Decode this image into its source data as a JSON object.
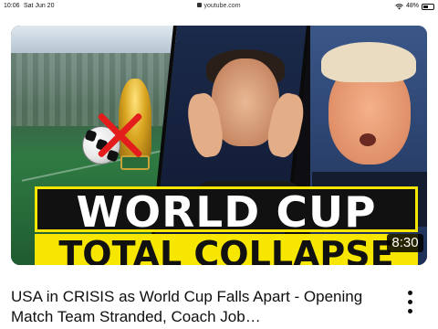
{
  "status_bar": {
    "time": "10:06",
    "date": "Sat Jun 20",
    "url": "youtube.com",
    "battery_text": "48%",
    "battery_level": 0.48
  },
  "video": {
    "thumbnail": {
      "headline_line1": "WORLD CUP",
      "headline_line2": "TOTAL COLLAPSE",
      "duration": "8:30",
      "accent_color": "#f7e600",
      "cross_color": "#e31c1c"
    },
    "title": "USA in CRISIS as World Cup Falls Apart - Opening Match Team Stranded, Coach Job…",
    "more_icon": "kebab-menu-icon"
  }
}
